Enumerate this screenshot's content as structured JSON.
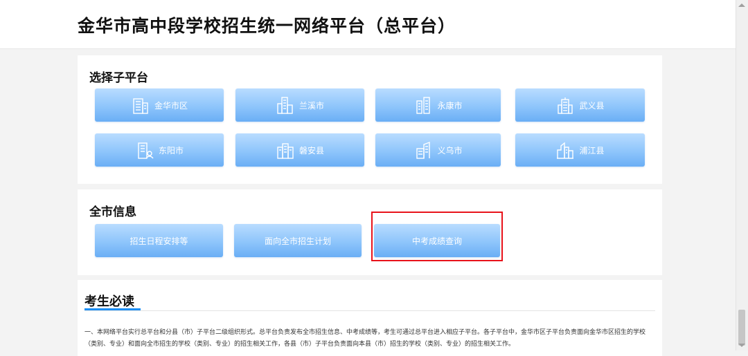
{
  "header": {
    "title": "金华市高中段学校招生统一网络平台（总平台）"
  },
  "sub_platform": {
    "heading": "选择子平台",
    "items": [
      {
        "label": "金华市区",
        "icon": "office-building-icon"
      },
      {
        "label": "兰溪市",
        "icon": "city-towers-icon"
      },
      {
        "label": "永康市",
        "icon": "twin-towers-icon"
      },
      {
        "label": "武义县",
        "icon": "tower-building-icon"
      },
      {
        "label": "东阳市",
        "icon": "building-user-icon"
      },
      {
        "label": "磐安县",
        "icon": "apartment-blocks-icon"
      },
      {
        "label": "义乌市",
        "icon": "skyscraper-icon"
      },
      {
        "label": "浦江县",
        "icon": "city-skyline-icon"
      }
    ]
  },
  "city_info": {
    "heading": "全市信息",
    "buttons": [
      {
        "label": "招生日程安排等"
      },
      {
        "label": "面向全市招生计划"
      },
      {
        "label": "中考成绩查询"
      }
    ],
    "highlighted": "中考成绩查询",
    "highlight_color": "#e8121a"
  },
  "notice": {
    "title": "考生必读",
    "text": "一、本网络平台实行总平台和分县（市）子平台二级组织形式。总平台负责发布全市招生信息、中考成绩等，考生可通过总平台进入相应子平台。各子平台中，金华市区子平台负责面向金华市区招生的学校（类别、专业）和面向全市招生的学校（类别、专业）的招生相关工作，各县（市）子平台负责面向本县（市）招生的学校（类别、专业）的招生相关工作。",
    "accent_color": "#1b8ef5"
  },
  "colors": {
    "button_top": "#b9dcff",
    "button_bottom": "#6aaef5",
    "page_bg": "#f3f3f3"
  }
}
